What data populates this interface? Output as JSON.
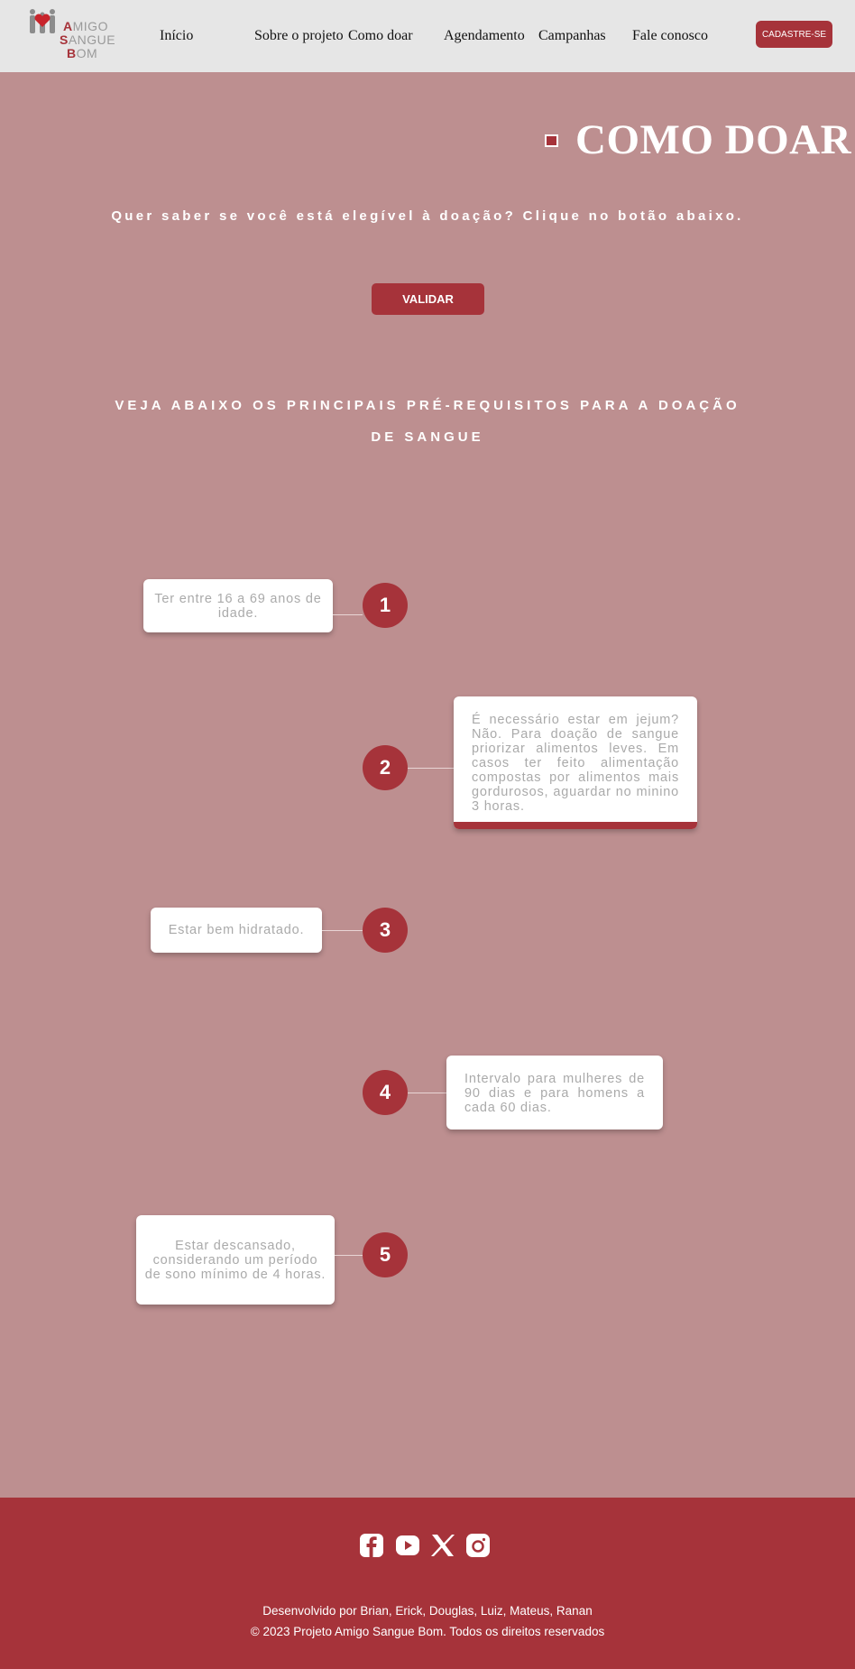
{
  "header": {
    "logo": {
      "line1_initial": "A",
      "line1_rest": "MIGO",
      "line2_initial": "S",
      "line2_rest": "ANGUE",
      "line3_initial": "B",
      "line3_rest": "OM"
    },
    "nav": [
      "Início",
      "Sobre o projeto",
      "Como doar",
      "Agendamento",
      "Campanhas",
      "Fale conosco"
    ],
    "cta_label": "CADASTRE-SE"
  },
  "colors": {
    "primary": "#a6333a",
    "background": "#bd8f90",
    "header_bg": "#e6e6e6"
  },
  "main": {
    "title": "COMO DOAR",
    "eligibility_prompt": "Quer saber se você está elegível à doação? Clique no botão abaixo.",
    "validate_label": "VALIDAR",
    "requirements_title": "VEJA ABAIXO OS PRINCIPAIS PRÉ-REQUISITOS PARA A DOAÇÃO DE SANGUE",
    "requirements": [
      {
        "number": "1",
        "text": "Ter entre 16 a 69 anos de idade."
      },
      {
        "number": "2",
        "text": "É necessário estar em jejum? Não. Para doação de sangue priorizar alimentos leves. Em casos ter feito alimentação compostas por alimentos mais gordurosos, aguardar no minino 3 horas."
      },
      {
        "number": "3",
        "text": "Estar bem hidratado."
      },
      {
        "number": "4",
        "text": "Intervalo para mulheres de 90 dias e para homens a cada 60 dias."
      },
      {
        "number": "5",
        "text": "Estar descansado, considerando um período de sono mínimo de 4 horas."
      }
    ]
  },
  "footer": {
    "social_icons": [
      "facebook-icon",
      "youtube-icon",
      "x-icon",
      "instagram-icon"
    ],
    "credits": "Desenvolvido por Brian, Erick, Douglas, Luiz, Mateus, Ranan",
    "copyright": "© 2023 Projeto Amigo Sangue Bom. Todos os direitos reservados"
  }
}
